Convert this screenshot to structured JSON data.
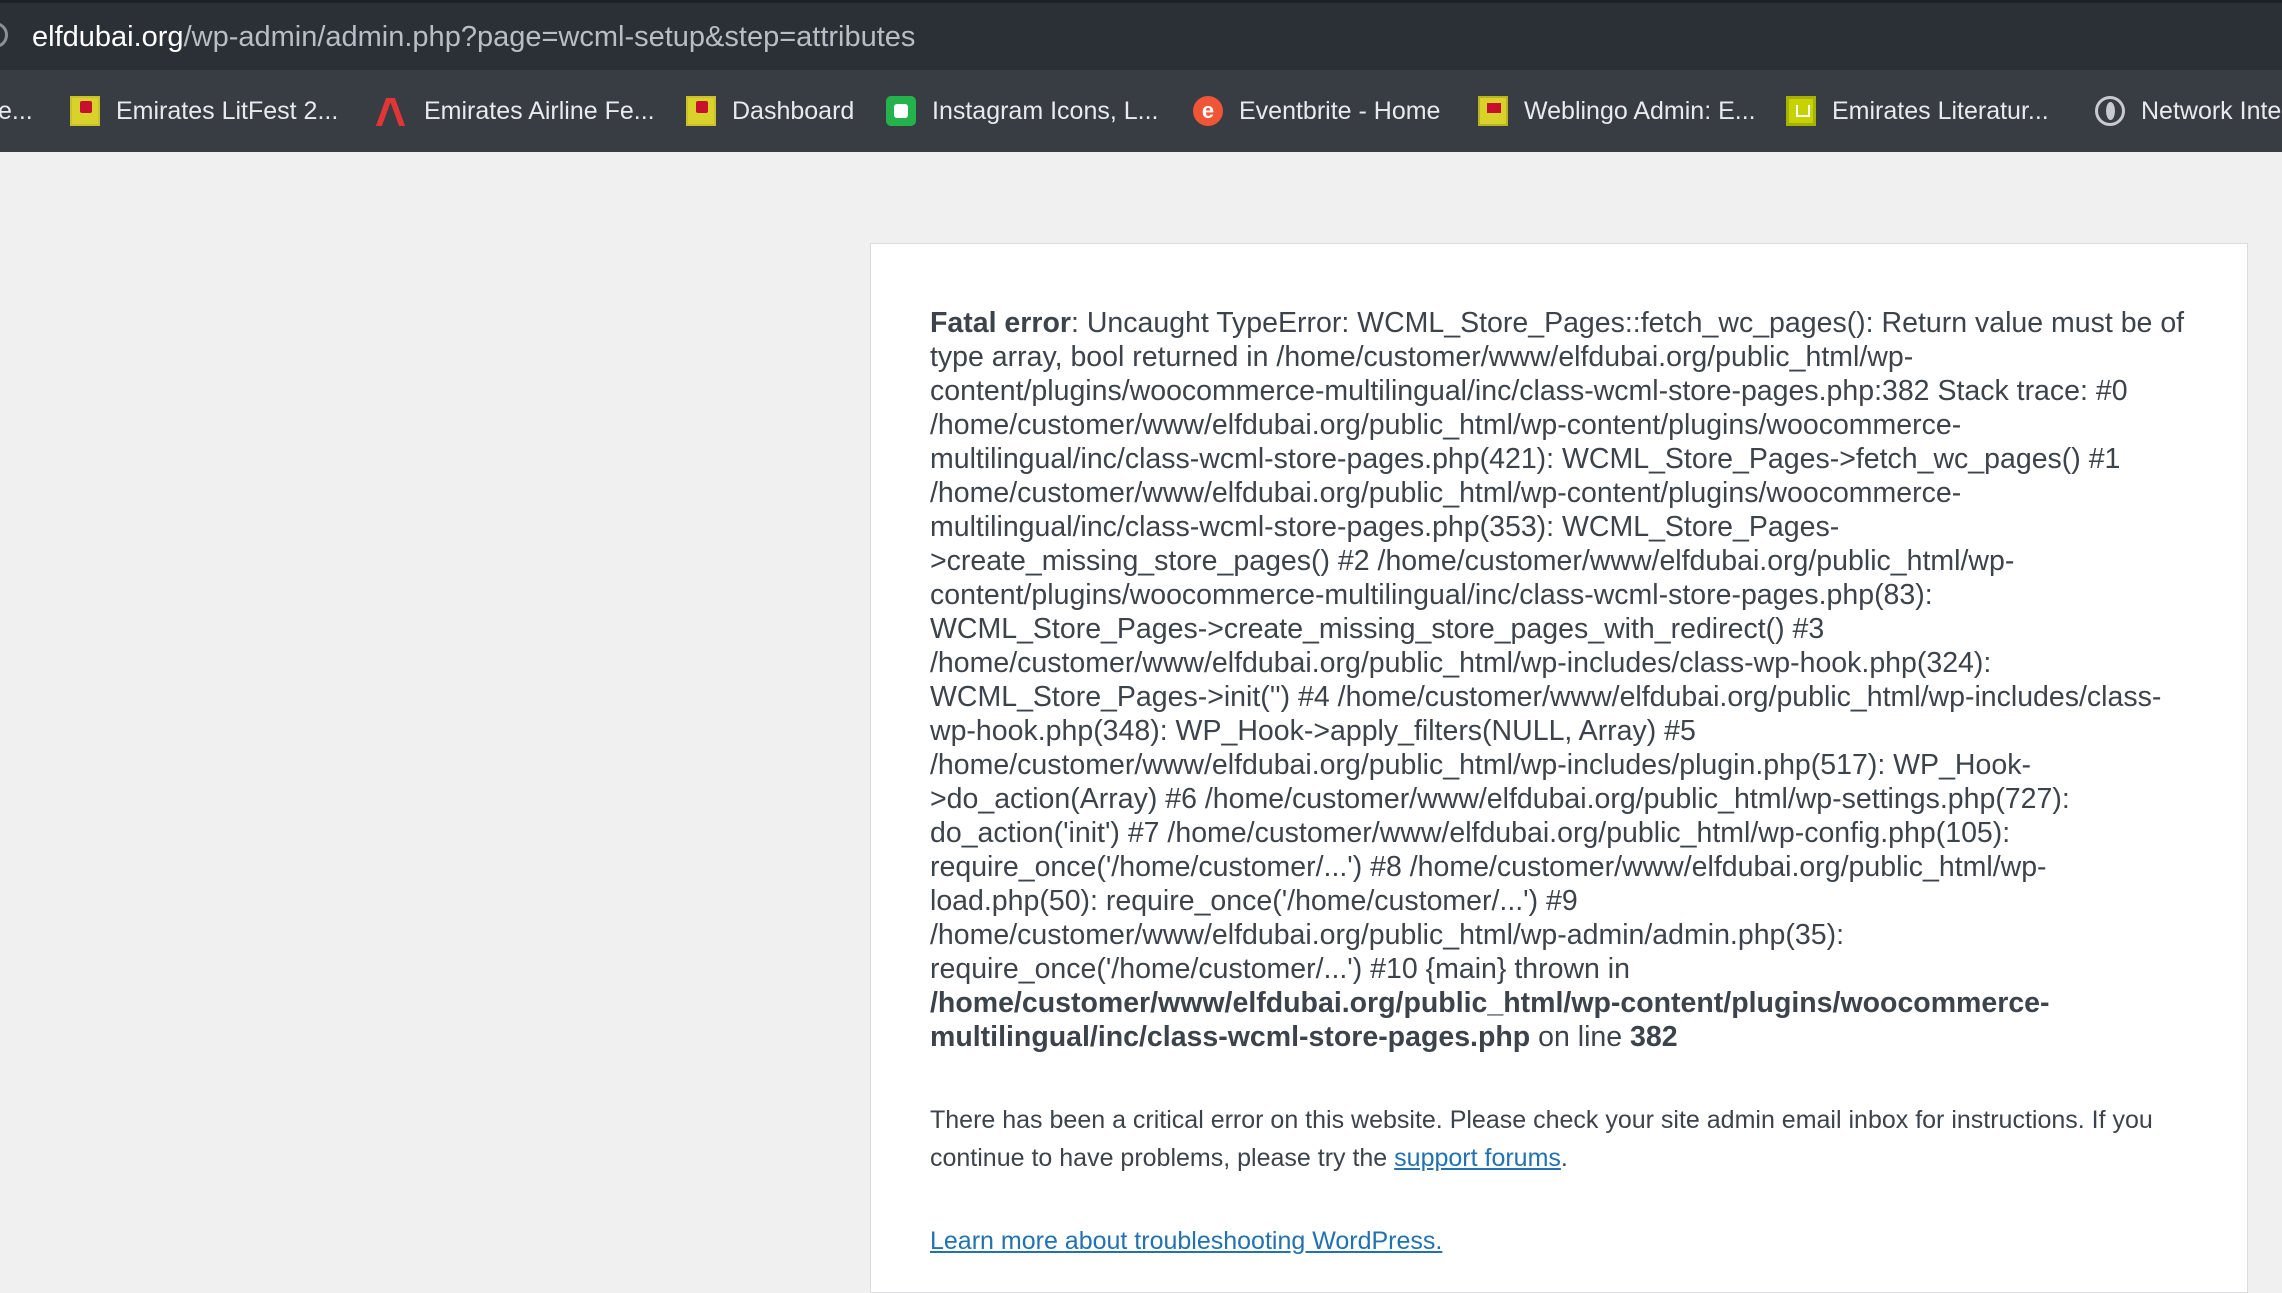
{
  "browser": {
    "url_host": "elfdubai.org",
    "url_path": "/wp-admin/admin.php?page=wcml-setup&step=attributes"
  },
  "bookmarks": [
    {
      "label": "e...",
      "icon": "clipped-bookmark-icon"
    },
    {
      "label": "Emirates LitFest 2...",
      "icon": "emirates-litfest-icon"
    },
    {
      "label": "Emirates Airline Fe...",
      "icon": "emirates-airline-icon"
    },
    {
      "label": "Dashboard",
      "icon": "emirates-litfest-icon"
    },
    {
      "label": "Instagram Icons, L...",
      "icon": "green-app-icon"
    },
    {
      "label": "Eventbrite - Home",
      "icon": "eventbrite-icon"
    },
    {
      "label": "Weblingo Admin: E...",
      "icon": "weblingo-icon"
    },
    {
      "label": "Emirates Literatur...",
      "icon": "emirates-literature-icon"
    },
    {
      "label": "Network Inte",
      "icon": "globe-icon"
    }
  ],
  "error": {
    "label": "Fatal error",
    "message": ": Uncaught TypeError: WCML_Store_Pages::fetch_wc_pages(): Return value must be of type array, bool returned in /home/customer/www/elfdubai.org/public_html/wp-content/plugins/woocommerce-multilingual/inc/class-wcml-store-pages.php:382 Stack trace: #0 /home/customer/www/elfdubai.org/public_html/wp-content/plugins/woocommerce-multilingual/inc/class-wcml-store-pages.php(421): WCML_Store_Pages->fetch_wc_pages() #1 /home/customer/www/elfdubai.org/public_html/wp-content/plugins/woocommerce-multilingual/inc/class-wcml-store-pages.php(353): WCML_Store_Pages->create_missing_store_pages() #2 /home/customer/www/elfdubai.org/public_html/wp-content/plugins/woocommerce-multilingual/inc/class-wcml-store-pages.php(83): WCML_Store_Pages->create_missing_store_pages_with_redirect() #3 /home/customer/www/elfdubai.org/public_html/wp-includes/class-wp-hook.php(324): WCML_Store_Pages->init('') #4 /home/customer/www/elfdubai.org/public_html/wp-includes/class-wp-hook.php(348): WP_Hook->apply_filters(NULL, Array) #5 /home/customer/www/elfdubai.org/public_html/wp-includes/plugin.php(517): WP_Hook->do_action(Array) #6 /home/customer/www/elfdubai.org/public_html/wp-settings.php(727): do_action('init') #7 /home/customer/www/elfdubai.org/public_html/wp-config.php(105): require_once('/home/customer/...') #8 /home/customer/www/elfdubai.org/public_html/wp-load.php(50): require_once('/home/customer/...') #9 /home/customer/www/elfdubai.org/public_html/wp-admin/admin.php(35): require_once('/home/customer/...') #10 {main} thrown in ",
    "file": "/home/customer/www/elfdubai.org/public_html/wp-content/plugins/woocommerce-multilingual/inc/class-wcml-store-pages.php",
    "on_line_text": " on line ",
    "line": "382"
  },
  "notice": {
    "text_before": "There has been a critical error on this website. Please check your site admin email inbox for instructions. If you continue to have problems, please try the ",
    "support_link": "support forums",
    "text_after": "."
  },
  "learn_more": "Learn more about troubleshooting WordPress."
}
